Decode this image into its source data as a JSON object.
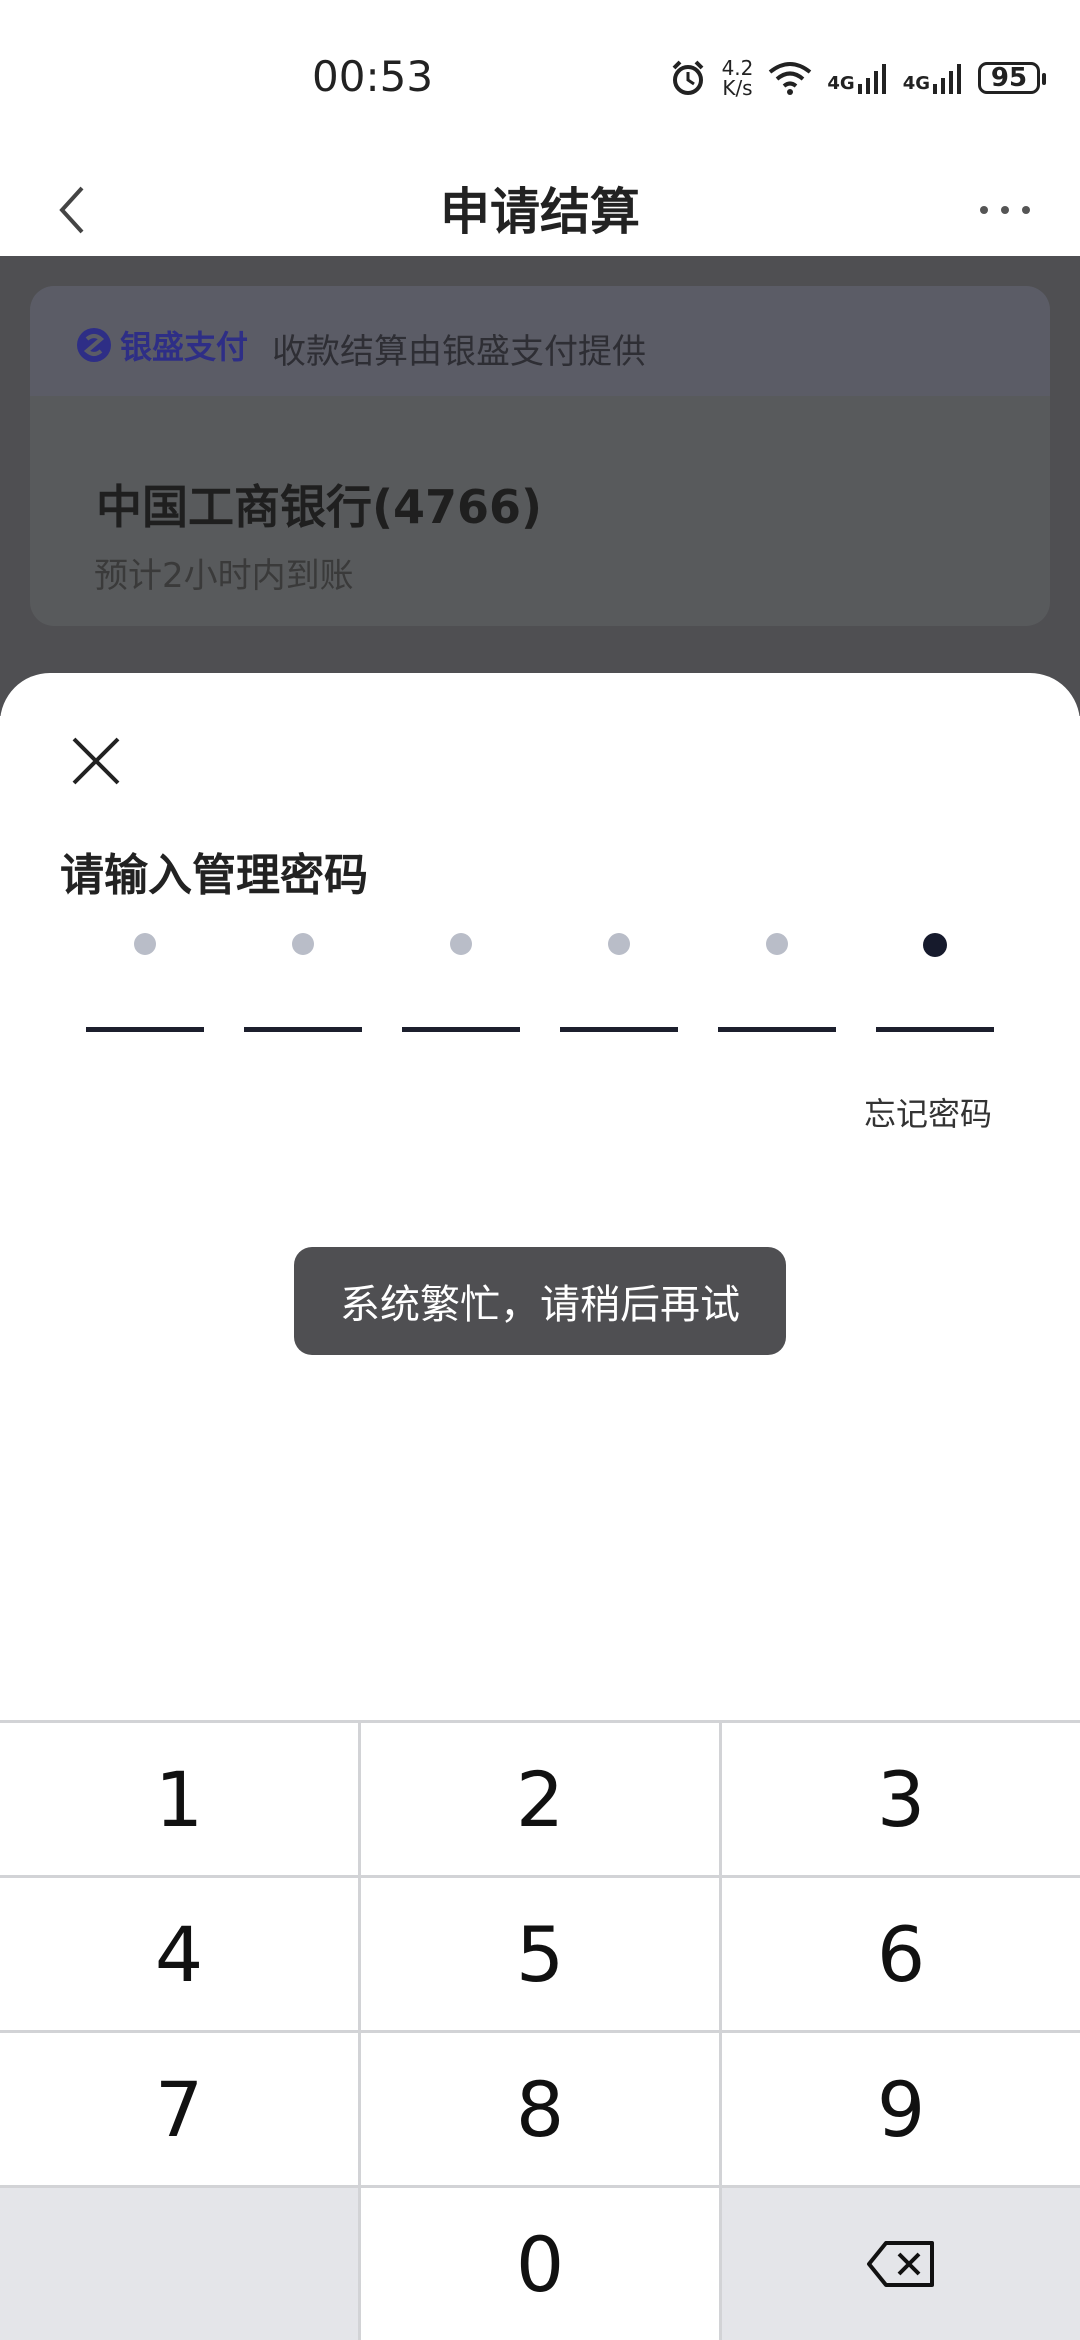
{
  "status_bar": {
    "time": "00:53",
    "speed_value": "4.2",
    "speed_unit": "K/s",
    "net1": "4G",
    "net2": "4G",
    "battery": "95",
    "icons": [
      "alarm-icon",
      "wifi-icon",
      "signal-icon",
      "signal-icon",
      "battery-icon"
    ]
  },
  "nav": {
    "title": "申请结算",
    "back_icon": "chevron-left-icon",
    "more_icon": "more-horizontal-icon"
  },
  "card": {
    "provider_logo_text": "银盛支付",
    "provider_note": "收款结算由银盛支付提供",
    "bank_name": "中国工商银行(4766)",
    "eta": "预计2小时内到账"
  },
  "sheet": {
    "title": "请输入管理密码",
    "forgot_password": "忘记密码",
    "pin_length": 6,
    "pin_filled_index": 5,
    "close_icon": "close-icon"
  },
  "toast": {
    "message": "系统繁忙，请稍后再试"
  },
  "keypad": {
    "keys": [
      "1",
      "2",
      "3",
      "4",
      "5",
      "6",
      "7",
      "8",
      "9",
      "",
      "0",
      "⌫"
    ]
  },
  "colors": {
    "overlay": "#4f4f52",
    "toast_bg": "#4f4f52",
    "pin_active": "#161a2c",
    "pin_inactive": "#b9bdc8",
    "keypad_gray": "#e4e5e9"
  }
}
